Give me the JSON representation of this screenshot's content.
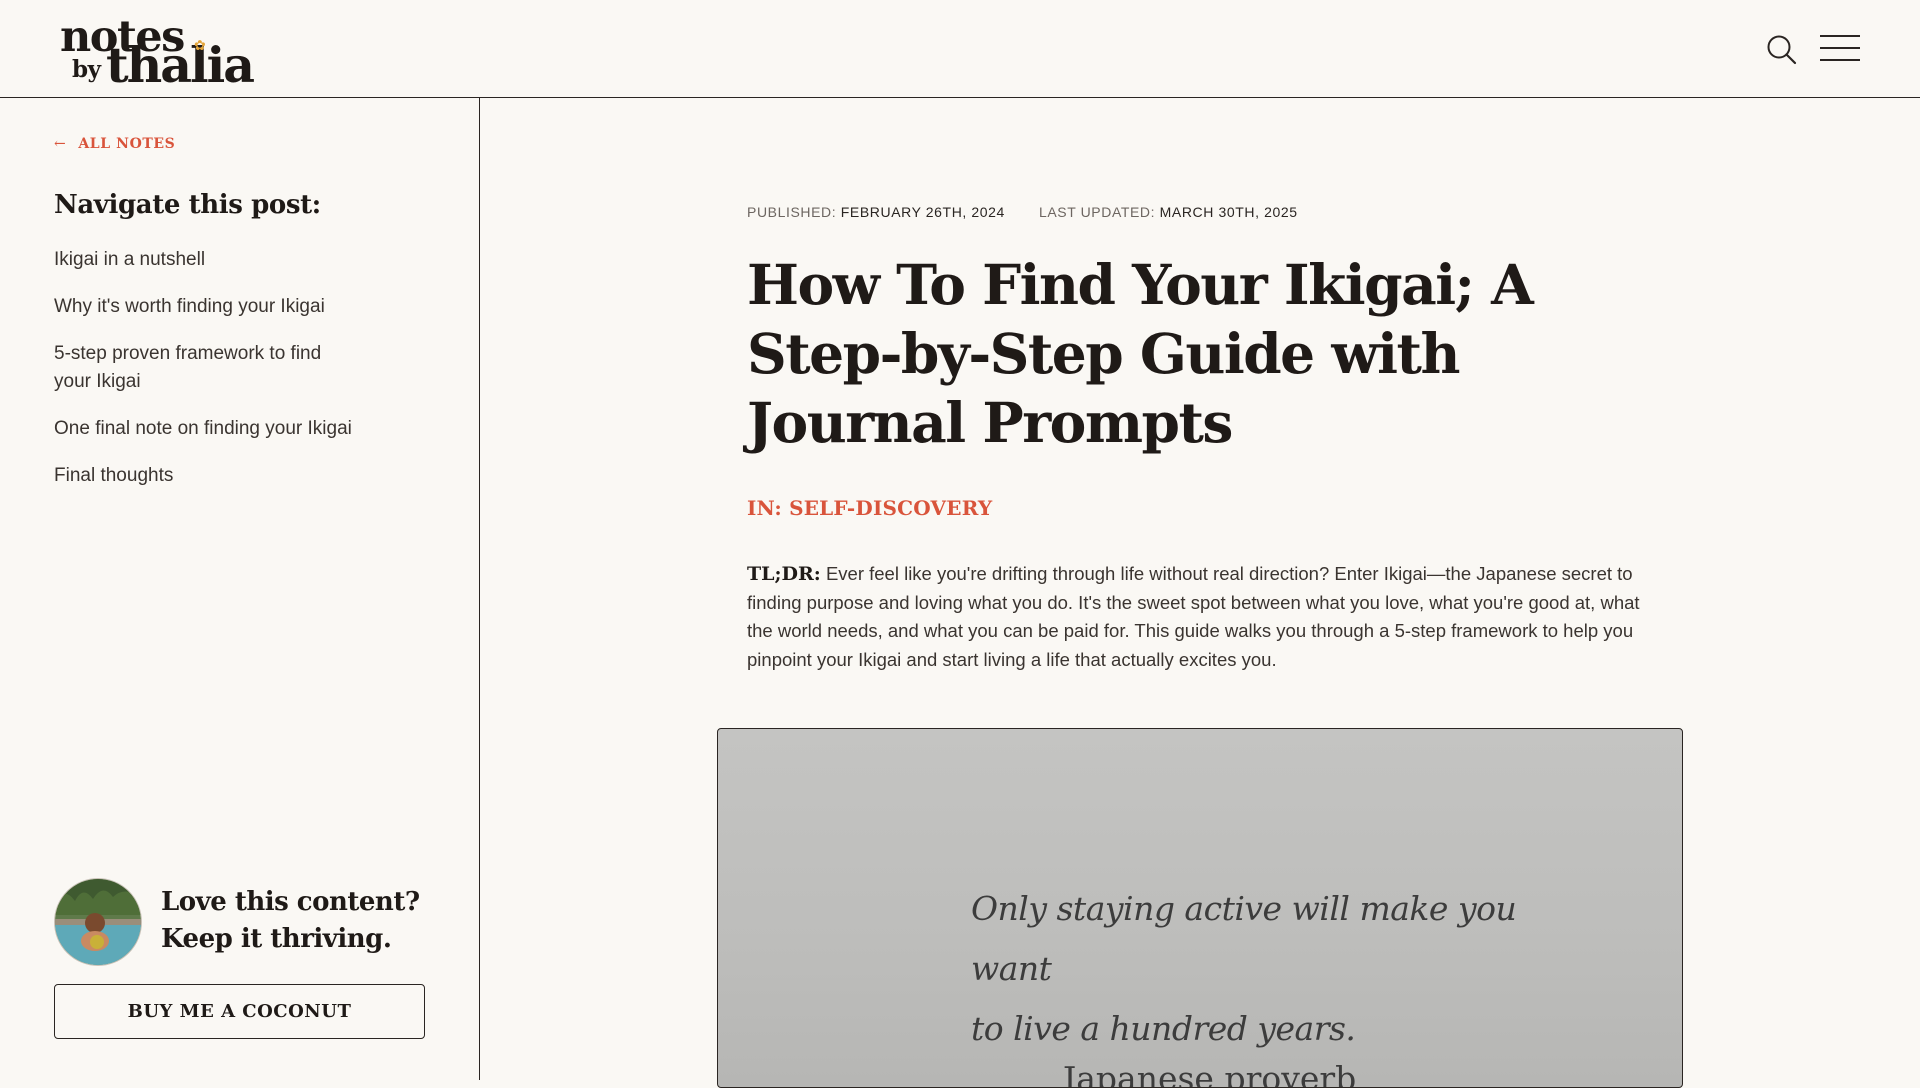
{
  "header": {
    "logo_line1": "notes",
    "logo_line2": "by",
    "logo_line3": "thalia",
    "logo_accent_color": "#e4a53a"
  },
  "sidebar": {
    "back_link": "ALL NOTES",
    "nav_title": "Navigate this post:",
    "toc": [
      "Ikigai in a nutshell",
      "Why it's worth finding your Ikigai",
      "5-step proven framework to find your Ikigai",
      "One final note on finding your Ikigai",
      "Final thoughts"
    ],
    "promo_line1": "Love this content?",
    "promo_line2": "Keep it thriving.",
    "promo_button": "BUY ME A COCONUT"
  },
  "article": {
    "published_label": "PUBLISHED:",
    "published_date": "FEBRUARY 26TH, 2024",
    "updated_label": "LAST UPDATED:",
    "updated_date": "MARCH 30TH, 2025",
    "title": "How To Find Your Ikigai; A Step-by-Step Guide with Journal Prompts",
    "category": "IN: SELF-DISCOVERY",
    "tldr_label": "TL;DR:",
    "tldr_text": "Ever feel like you're drifting through life without real direction? Enter Ikigai—the Japanese secret to finding purpose and loving what you do. It's the sweet spot between what you love, what you're good at, what the world needs, and what you can be paid for. This guide walks you through a 5-step framework to help you pinpoint your Ikigai and start living a life that actually excites you.",
    "hero_quote_line1": "Only staying active will make you want",
    "hero_quote_line2": "to live a hundred years.",
    "hero_attribution": "Japanese proverb"
  },
  "colors": {
    "background": "#faf8f4",
    "accent": "#d9543b",
    "text": "#2a2522"
  }
}
